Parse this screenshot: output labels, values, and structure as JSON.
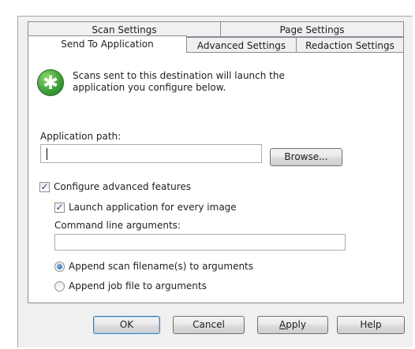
{
  "tabs": {
    "back_row": [
      "Scan Settings",
      "Page Settings"
    ],
    "front_row": [
      "Send To Application",
      "Advanced Settings",
      "Redaction Settings"
    ]
  },
  "info": {
    "icon": "green-star-icon",
    "line1": "Scans sent to this destination will launch the",
    "line2": "application you configure below."
  },
  "application_path": {
    "label": "Application path:",
    "value": ""
  },
  "browse_label": "Browse...",
  "configure": {
    "label": "Configure advanced features",
    "checked": true
  },
  "launch": {
    "label": "Launch application for every image",
    "checked": true
  },
  "command_line": {
    "label": "Command line arguments:",
    "value": ""
  },
  "radio_options": [
    {
      "label": "Append scan filename(s) to arguments",
      "selected": true
    },
    {
      "label": "Append job file to arguments",
      "selected": false
    }
  ],
  "buttons": {
    "ok": "OK",
    "cancel": "Cancel",
    "apply_prefix": "",
    "apply_accel": "A",
    "apply_rest": "pply",
    "help": "Help"
  },
  "colors": {
    "accent": "#3c7fb1",
    "icon_green": "#3fa23a",
    "tab_border": "#898c95"
  }
}
